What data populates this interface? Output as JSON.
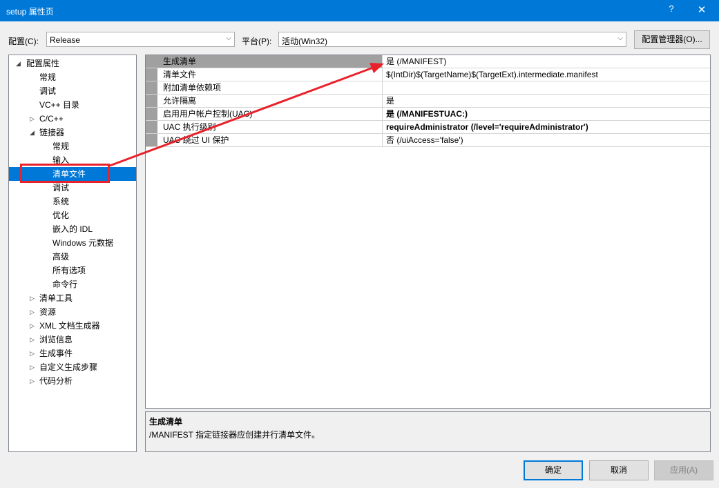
{
  "window": {
    "title": "setup 属性页",
    "help_label": "?",
    "close_label": "✕"
  },
  "toolbar": {
    "config_label": "配置(C):",
    "config_value": "Release",
    "platform_label": "平台(P):",
    "platform_value": "活动(Win32)",
    "config_manager_label": "配置管理器(O)...",
    "dropdown_arrow": "⌵"
  },
  "tree": {
    "root": "配置属性",
    "items": [
      {
        "label": "常规"
      },
      {
        "label": "调试"
      },
      {
        "label": "VC++ 目录"
      },
      {
        "label": "C/C++"
      },
      {
        "label": "链接器"
      },
      {
        "label": "常规"
      },
      {
        "label": "输入"
      },
      {
        "label": "清单文件"
      },
      {
        "label": "调试"
      },
      {
        "label": "系统"
      },
      {
        "label": "优化"
      },
      {
        "label": "嵌入的 IDL"
      },
      {
        "label": "Windows 元数据"
      },
      {
        "label": "高级"
      },
      {
        "label": "所有选项"
      },
      {
        "label": "命令行"
      },
      {
        "label": "清单工具"
      },
      {
        "label": "资源"
      },
      {
        "label": "XML 文档生成器"
      },
      {
        "label": "浏览信息"
      },
      {
        "label": "生成事件"
      },
      {
        "label": "自定义生成步骤"
      },
      {
        "label": "代码分析"
      }
    ],
    "expanded_glyph": "◢",
    "collapsed_glyph": "▷",
    "selected_label": "清单文件"
  },
  "properties": [
    {
      "name": "生成清单",
      "value": "是 (/MANIFEST)"
    },
    {
      "name": "清单文件",
      "value": "$(IntDir)$(TargetName)$(TargetExt).intermediate.manifest"
    },
    {
      "name": "附加清单依赖项",
      "value": ""
    },
    {
      "name": "允许隔离",
      "value": "是"
    },
    {
      "name": "启用用户帐户控制(UAC)",
      "value": "是 (/MANIFESTUAC:)"
    },
    {
      "name": "UAC 执行级别",
      "value": "requireAdministrator (/level='requireAdministrator')"
    },
    {
      "name": "UAC 绕过 UI 保护",
      "value": "否 (/uiAccess='false')"
    }
  ],
  "description": {
    "title": "生成清单",
    "text": "/MANIFEST 指定链接器应创建并行清单文件。"
  },
  "buttons": {
    "ok": "确定",
    "cancel": "取消",
    "apply": "应用(A)"
  },
  "annotation": {
    "color": "#e8212b"
  }
}
